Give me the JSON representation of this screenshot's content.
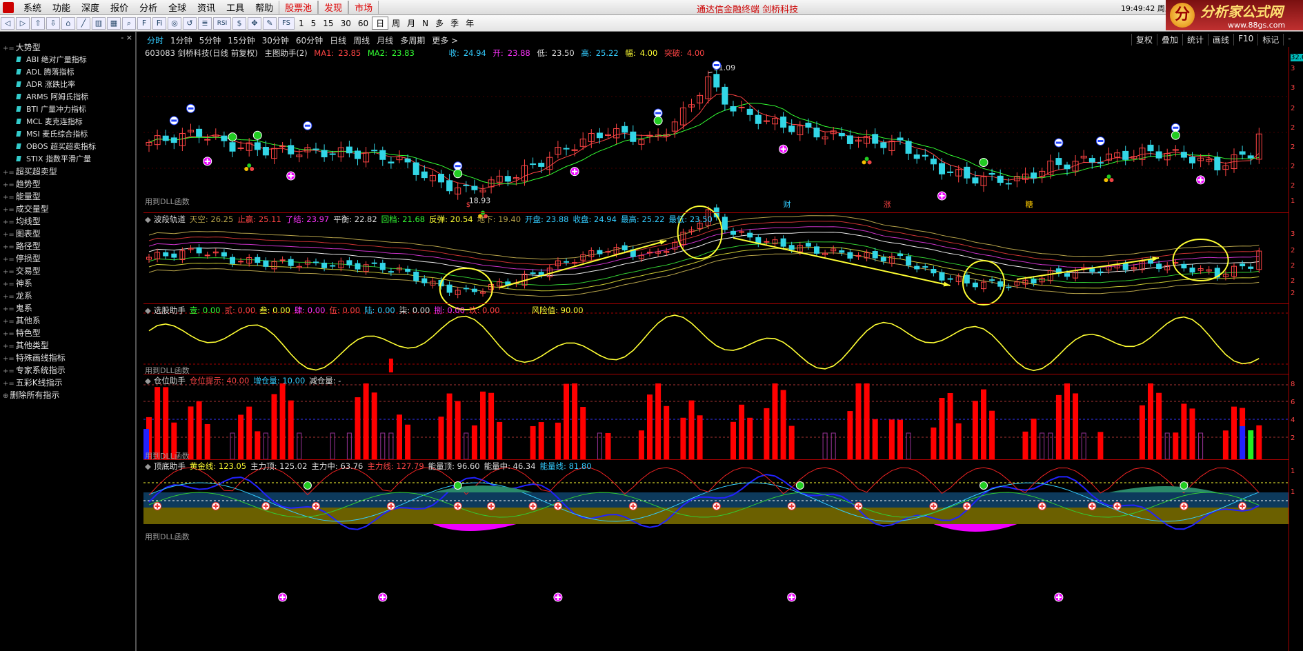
{
  "menu": {
    "items": [
      "系统",
      "功能",
      "深度",
      "报价",
      "分析",
      "全球",
      "资讯",
      "工具",
      "帮助"
    ],
    "stock_pool": "股票池",
    "discover": "发现",
    "market": "市场",
    "window_title": "通达信金融终端  剑桥科技",
    "clock": "19:49:42 周三"
  },
  "logo": {
    "text": "分析家公式网",
    "url": "www.88gs.com",
    "mark": "分"
  },
  "toolbar": {
    "icons": [
      "back-icon",
      "forward-icon",
      "down-icon",
      "home-icon",
      "line-chart-icon",
      "bar-chart-icon",
      "grid-icon",
      "search-icon",
      "f10-icon",
      "fiz-icon",
      "camera-icon",
      "refresh-icon",
      "ruler-icon",
      "rsi-icon",
      "dollar-icon",
      "move-icon",
      "pencil-icon",
      "fs-icon"
    ],
    "rsi_label": "RSI",
    "fs_label": "FS",
    "periods": [
      "1",
      "5",
      "15",
      "30",
      "60",
      "日",
      "周",
      "月",
      "N",
      "多",
      "季",
      "年"
    ],
    "active_period": "日"
  },
  "sidebar": {
    "ctl": "- ×",
    "tree": [
      {
        "label": "大势型",
        "children": [
          "ABI 绝对广量指标",
          "ADL 腾落指标",
          "ADR 涨跌比率",
          "ARMS 阿姆氏指标",
          "BTI 广量冲力指标",
          "MCL 麦克连指标",
          "MSI 麦氏综合指标",
          "OBOS 超买超卖指标",
          "STIX 指数平滑广量"
        ]
      },
      {
        "label": "超买超卖型"
      },
      {
        "label": "趋势型"
      },
      {
        "label": "能量型"
      },
      {
        "label": "成交量型"
      },
      {
        "label": "均线型"
      },
      {
        "label": "图表型"
      },
      {
        "label": "路径型"
      },
      {
        "label": "停损型"
      },
      {
        "label": "交易型"
      },
      {
        "label": "神系"
      },
      {
        "label": "龙系"
      },
      {
        "label": "鬼系"
      },
      {
        "label": "其他系"
      },
      {
        "label": "特色型"
      },
      {
        "label": "其他类型"
      },
      {
        "label": "特殊画线指标"
      },
      {
        "label": "专家系统指示"
      },
      {
        "label": "五彩K线指示"
      },
      {
        "label": "删除所有指示",
        "leaf": true
      }
    ]
  },
  "periodbar": {
    "items": [
      "分时",
      "1分钟",
      "5分钟",
      "15分钟",
      "30分钟",
      "60分钟",
      "日线",
      "周线",
      "月线",
      "多周期",
      "更多 >"
    ],
    "selected": "分时"
  },
  "rightbtns": [
    "复权",
    "叠加",
    "统计",
    "画线",
    "F10",
    "标记",
    "-"
  ],
  "panels": {
    "main": {
      "code": "603083 剑桥科技(日线 前复权)",
      "helper": "主图助手(2)",
      "ma1_label": "MA1:",
      "ma1": "23.85",
      "ma2_label": "MA2:",
      "ma2": "23.83",
      "close_label": "收:",
      "close": "24.94",
      "open_label": "开:",
      "open": "23.88",
      "low_label": "低:",
      "low": "23.50",
      "high_label": "高:",
      "high": "25.22",
      "amp_label": "幅:",
      "amp": "4.00",
      "break_label": "突破:",
      "break": "4.00",
      "peak_label": "31.09",
      "trough_label": "18.93",
      "dll": "用到DLL函数",
      "markers": [
        "财",
        "涨",
        "糖"
      ],
      "marker_s": "$"
    },
    "band": {
      "name": "波段轨道",
      "items": [
        [
          "天空:",
          "26.25",
          "c-olive"
        ],
        [
          "止赢:",
          "25.11",
          "c-r"
        ],
        [
          "了结:",
          "23.97",
          "c-m"
        ],
        [
          "平衡:",
          "22.82",
          "c-w"
        ],
        [
          "回档:",
          "21.68",
          "c-g"
        ],
        [
          "反弹:",
          "20.54",
          "c-y"
        ],
        [
          "地下:",
          "19.40",
          "c-olive"
        ],
        [
          "开盘:",
          "23.88",
          "c-c"
        ],
        [
          "收盘:",
          "24.94",
          "c-c"
        ],
        [
          "最高:",
          "25.22",
          "c-c"
        ],
        [
          "最低:",
          "23.50",
          "c-c"
        ]
      ]
    },
    "select": {
      "name": "选股助手",
      "items": [
        [
          "壹:",
          "0.00",
          "c-g"
        ],
        [
          "贰:",
          "0.00",
          "c-r"
        ],
        [
          "叁:",
          "0.00",
          "c-y"
        ],
        [
          "肆:",
          "0.00",
          "c-m"
        ],
        [
          "伍:",
          "0.00",
          "c-r"
        ],
        [
          "陆:",
          "0.00",
          "c-c"
        ],
        [
          "柒:",
          "0.00",
          "c-w"
        ],
        [
          "捌:",
          "0.00",
          "c-m"
        ],
        [
          "玖:",
          "0.00",
          "c-r"
        ]
      ],
      "risk_label": "风险值:",
      "risk": "90.00",
      "dll": "用到DLL函数"
    },
    "position": {
      "name": "仓位助手",
      "items": [
        [
          "仓位提示:",
          "40.00",
          "c-r"
        ],
        [
          "增仓量:",
          "10.00",
          "c-c"
        ],
        [
          "减仓量:",
          "-",
          "c-w"
        ]
      ],
      "dll": "用到DLL函数"
    },
    "topbottom": {
      "name": "顶底助手",
      "items": [
        [
          "黄金线:",
          "123.05",
          "c-y"
        ],
        [
          "主力顶:",
          "125.02",
          "c-w"
        ],
        [
          "主力中:",
          "63.76",
          "c-w"
        ],
        [
          "主力线:",
          "127.79",
          "c-r"
        ],
        [
          "能量顶:",
          "96.60",
          "c-w"
        ],
        [
          "能量中:",
          "46.34",
          "c-w"
        ],
        [
          "能量线:",
          "81.80",
          "c-c"
        ]
      ],
      "dll": "用到DLL函数"
    }
  },
  "axis": {
    "main_ticks": [
      "32.6",
      "3",
      "3",
      "2",
      "2",
      "2",
      "2",
      "2",
      "1"
    ],
    "sub_ticks": [
      "3",
      "2",
      "2",
      "2",
      "2",
      "8",
      "6",
      "4",
      "2",
      "1",
      "1"
    ]
  },
  "chart_data": {
    "type": "candlestick",
    "title": "603083 剑桥科技(日线 前复权)",
    "series": [
      {
        "name": "MA1",
        "color": "#ff4444"
      },
      {
        "name": "MA2",
        "color": "#33ff33"
      }
    ],
    "last": {
      "open": 23.88,
      "high": 25.22,
      "low": 23.5,
      "close": 24.94
    },
    "annotations": [
      {
        "text": "31.09",
        "type": "high"
      },
      {
        "text": "18.93",
        "type": "low"
      }
    ],
    "risk_value": 90.0,
    "position_hint": 40.0
  }
}
